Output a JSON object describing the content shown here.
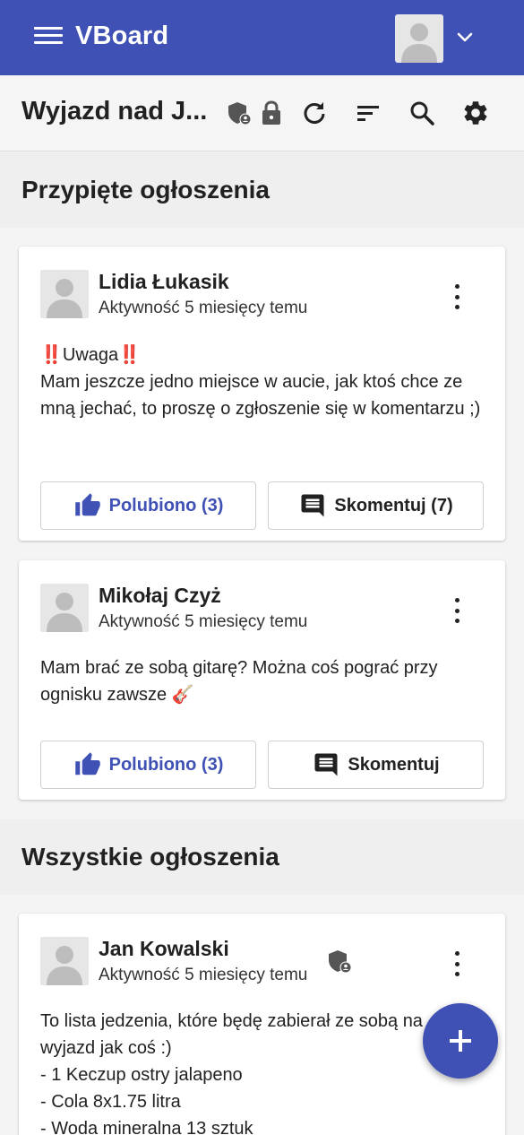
{
  "app": {
    "title": "VBoard",
    "accent_color": "#3f51b5",
    "menu_icon": "menu-icon",
    "user_icon": "user-avatar-icon",
    "dropdown_icon": "chevron-down-icon"
  },
  "toolbar": {
    "board_title": "Wyjazd nad J...",
    "icons": [
      "shield-user-icon",
      "lock-icon",
      "refresh-icon",
      "sort-icon",
      "search-icon",
      "settings-icon"
    ]
  },
  "sections": {
    "pinned_title": "Przypięte ogłoszenia",
    "all_title": "Wszystkie ogłoszenia"
  },
  "posts": [
    {
      "author": "Lidia Łukasik",
      "activity": "Aktywność 5 miesięcy temu",
      "body_prefix": "‼️",
      "body_word": "Uwaga",
      "body_suffix": "‼️",
      "body_text": "Mam jeszcze jedno miejsce w aucie, jak ktoś chce ze mną jechać, to proszę o zgłoszenie się w komentarzu ;)",
      "like_label": "Polubiono (3)",
      "comment_label": "Skomentuj (7)"
    },
    {
      "author": "Mikołaj Czyż",
      "activity": "Aktywność 5 miesięcy temu",
      "body_text": "Mam brać ze sobą gitarę? Można coś pograć przy ognisku zawsze 🎸",
      "like_label": "Polubiono (3)",
      "comment_label": "Skomentuj"
    },
    {
      "author": "Jan Kowalski",
      "activity": "Aktywność 5 miesięcy temu",
      "badge_icon": "shield-user-icon",
      "body_text": "To lista jedzenia, które będę zabierał ze sobą na\nwyjazd jak coś :)\n- 1 Keczup ostry jalapeno\n- Cola 8x1.75 litra\n- Woda mineralna 13 sztuk"
    }
  ],
  "fab": {
    "icon": "plus-icon"
  }
}
